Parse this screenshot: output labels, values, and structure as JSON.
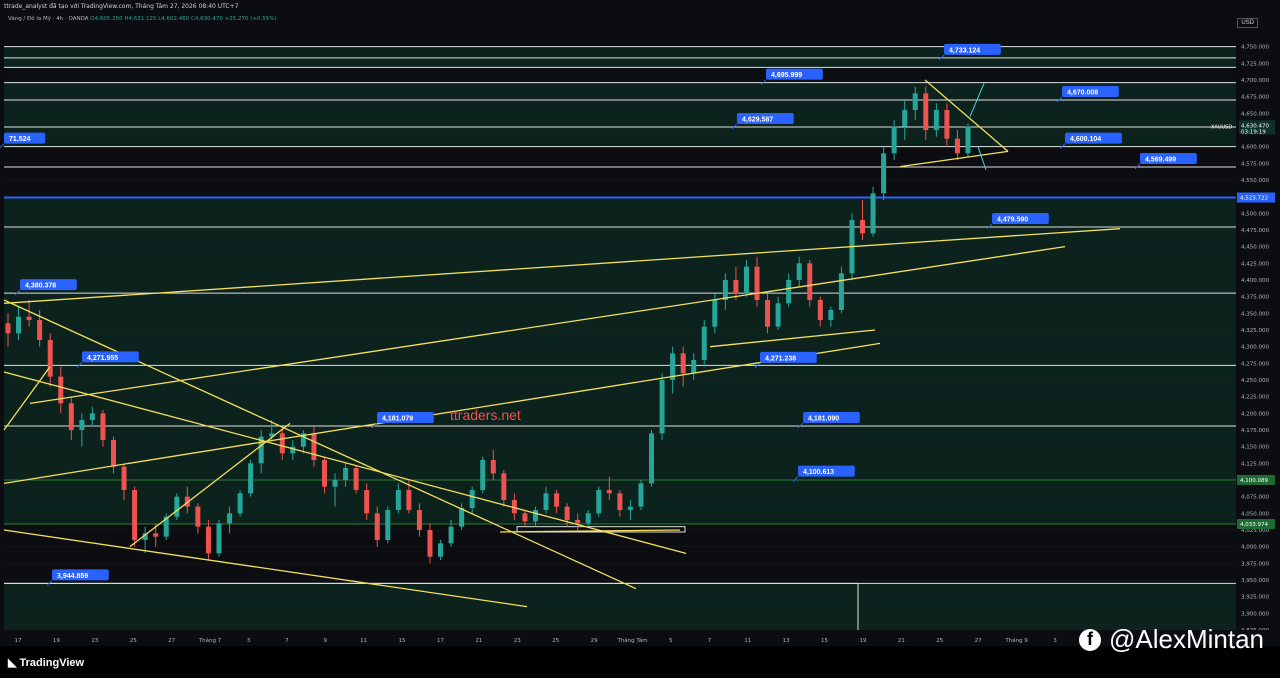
{
  "header": {
    "title": "ttrade_analyst đã tạo với TradingView.com, Tháng Tám 27, 2026 08:40 UTC+7",
    "symbol": "Vàng / Đô la Mỹ · 4h · OANDA",
    "ohlc": "O4,605.250  H4,631.125  L4,602.460  C4,630.470  +25.270 (+0.55%)",
    "currency": "USD"
  },
  "watermark": "ttraders.net",
  "footer": {
    "brand": "TradingView",
    "social": "@AlexMintan"
  },
  "colors": {
    "background": "#0b0d10",
    "zone_fill": "#0e2a22",
    "bull": "#26a69a",
    "bear": "#ef5350",
    "trend": "#f5e05a",
    "label": "#2962ff",
    "blue_line": "#2962ff"
  },
  "chart_data": {
    "type": "candlestick",
    "symbol": "XAUUSD",
    "ylim": [
      3875,
      4775
    ],
    "y_ticks": [
      3875,
      3900,
      3925,
      3950,
      3975,
      4000,
      4025,
      4050,
      4075,
      4100,
      4125,
      4150,
      4175,
      4200,
      4225,
      4250,
      4275,
      4300,
      4325,
      4350,
      4375,
      4400,
      4425,
      4450,
      4475,
      4500,
      4525,
      4550,
      4575,
      4600,
      4625,
      4650,
      4675,
      4700,
      4725,
      4750
    ],
    "x_ticks": [
      "17",
      "19",
      "23",
      "25",
      "27",
      "Tháng 7",
      "3",
      "7",
      "9",
      "11",
      "15",
      "17",
      "21",
      "23",
      "25",
      "29",
      "Tháng Tám",
      "5",
      "7",
      "11",
      "13",
      "15",
      "19",
      "21",
      "25",
      "27",
      "Tháng 9",
      "3"
    ],
    "current_price": {
      "label": "XAUUSD",
      "value": "4,630.470",
      "countdown": "03:19:19"
    },
    "level_tags": [
      {
        "value": "4,523.722",
        "color": "#2962ff"
      },
      {
        "value": "4,100.089",
        "color": "#1e6b32"
      },
      {
        "value": "4,033.974",
        "color": "#1e6b32"
      }
    ],
    "horizontal_levels": [
      4750,
      4733.124,
      4719,
      4695.999,
      4670.008,
      4629.587,
      4600.104,
      4569.499,
      4523.722,
      4479.59,
      4380.378,
      4271.955,
      4181.079,
      4100.089,
      4033.974,
      3944.859
    ],
    "price_labels": [
      "4,733.124",
      "4,695.999",
      "4,670.008",
      "4,629.587",
      "4,600.104",
      "4,569.499",
      "71.524",
      "4,479.590",
      "4,380.378",
      "4,271.955",
      "4,271.238",
      "4,181.079",
      "4,181.090",
      "4,100.613",
      "3,944.859"
    ],
    "ohlc_series": [
      [
        4335,
        4350,
        4300,
        4320
      ],
      [
        4320,
        4360,
        4310,
        4345
      ],
      [
        4345,
        4370,
        4330,
        4340
      ],
      [
        4340,
        4355,
        4300,
        4310
      ],
      [
        4310,
        4320,
        4240,
        4255
      ],
      [
        4255,
        4270,
        4200,
        4215
      ],
      [
        4215,
        4225,
        4160,
        4175
      ],
      [
        4175,
        4200,
        4150,
        4190
      ],
      [
        4190,
        4210,
        4180,
        4200
      ],
      [
        4200,
        4205,
        4150,
        4160
      ],
      [
        4160,
        4165,
        4110,
        4120
      ],
      [
        4120,
        4125,
        4070,
        4085
      ],
      [
        4085,
        4090,
        4000,
        4010
      ],
      [
        4010,
        4030,
        3990,
        4020
      ],
      [
        4020,
        4035,
        4000,
        4015
      ],
      [
        4015,
        4050,
        4010,
        4045
      ],
      [
        4045,
        4080,
        4040,
        4075
      ],
      [
        4075,
        4090,
        4050,
        4060
      ],
      [
        4060,
        4065,
        4020,
        4030
      ],
      [
        4030,
        4040,
        3980,
        3990
      ],
      [
        3990,
        4040,
        3985,
        4035
      ],
      [
        4035,
        4060,
        4020,
        4050
      ],
      [
        4050,
        4085,
        4045,
        4080
      ],
      [
        4080,
        4130,
        4075,
        4125
      ],
      [
        4125,
        4175,
        4110,
        4165
      ],
      [
        4165,
        4190,
        4160,
        4170
      ],
      [
        4170,
        4175,
        4130,
        4140
      ],
      [
        4140,
        4160,
        4130,
        4150
      ],
      [
        4150,
        4175,
        4140,
        4170
      ],
      [
        4170,
        4180,
        4120,
        4130
      ],
      [
        4130,
        4135,
        4080,
        4090
      ],
      [
        4090,
        4110,
        4060,
        4100
      ],
      [
        4100,
        4125,
        4090,
        4118
      ],
      [
        4118,
        4122,
        4080,
        4085
      ],
      [
        4085,
        4095,
        4040,
        4050
      ],
      [
        4050,
        4060,
        4000,
        4010
      ],
      [
        4010,
        4060,
        4005,
        4055
      ],
      [
        4055,
        4095,
        4050,
        4085
      ],
      [
        4085,
        4100,
        4050,
        4055
      ],
      [
        4055,
        4065,
        4015,
        4025
      ],
      [
        4025,
        4035,
        3975,
        3985
      ],
      [
        3985,
        4010,
        3980,
        4005
      ],
      [
        4005,
        4040,
        4000,
        4030
      ],
      [
        4030,
        4065,
        4025,
        4058
      ],
      [
        4058,
        4090,
        4050,
        4085
      ],
      [
        4085,
        4135,
        4080,
        4130
      ],
      [
        4130,
        4145,
        4100,
        4110
      ],
      [
        4110,
        4115,
        4060,
        4070
      ],
      [
        4070,
        4080,
        4040,
        4050
      ],
      [
        4050,
        4055,
        4030,
        4038
      ],
      [
        4038,
        4060,
        4030,
        4055
      ],
      [
        4055,
        4090,
        4050,
        4080
      ],
      [
        4080,
        4085,
        4050,
        4060
      ],
      [
        4060,
        4065,
        4030,
        4040
      ],
      [
        4040,
        4050,
        4025,
        4035
      ],
      [
        4035,
        4055,
        4030,
        4050
      ],
      [
        4050,
        4090,
        4045,
        4085
      ],
      [
        4085,
        4105,
        4070,
        4080
      ],
      [
        4080,
        4085,
        4045,
        4055
      ],
      [
        4055,
        4070,
        4040,
        4060
      ],
      [
        4060,
        4100,
        4055,
        4095
      ],
      [
        4095,
        4175,
        4090,
        4170
      ],
      [
        4170,
        4260,
        4160,
        4250
      ],
      [
        4250,
        4300,
        4230,
        4290
      ],
      [
        4290,
        4300,
        4240,
        4260
      ],
      [
        4260,
        4290,
        4250,
        4280
      ],
      [
        4280,
        4340,
        4270,
        4330
      ],
      [
        4330,
        4380,
        4320,
        4370
      ],
      [
        4370,
        4410,
        4355,
        4400
      ],
      [
        4400,
        4420,
        4370,
        4380
      ],
      [
        4380,
        4430,
        4375,
        4420
      ],
      [
        4420,
        4435,
        4360,
        4370
      ],
      [
        4370,
        4380,
        4320,
        4330
      ],
      [
        4330,
        4375,
        4325,
        4365
      ],
      [
        4365,
        4410,
        4360,
        4400
      ],
      [
        4400,
        4435,
        4390,
        4425
      ],
      [
        4425,
        4430,
        4360,
        4370
      ],
      [
        4370,
        4375,
        4330,
        4340
      ],
      [
        4340,
        4360,
        4330,
        4355
      ],
      [
        4355,
        4420,
        4350,
        4410
      ],
      [
        4410,
        4500,
        4400,
        4490
      ],
      [
        4490,
        4520,
        4460,
        4470
      ],
      [
        4470,
        4540,
        4465,
        4530
      ],
      [
        4530,
        4600,
        4520,
        4590
      ],
      [
        4590,
        4640,
        4580,
        4630
      ],
      [
        4630,
        4670,
        4610,
        4655
      ],
      [
        4655,
        4690,
        4640,
        4680
      ],
      [
        4680,
        4690,
        4610,
        4625
      ],
      [
        4625,
        4665,
        4615,
        4655
      ],
      [
        4655,
        4665,
        4600,
        4612
      ],
      [
        4612,
        4625,
        4580,
        4590
      ],
      [
        4590,
        4635,
        4585,
        4630
      ]
    ],
    "x_range_bars": 160,
    "candles_start_bar": 0
  }
}
